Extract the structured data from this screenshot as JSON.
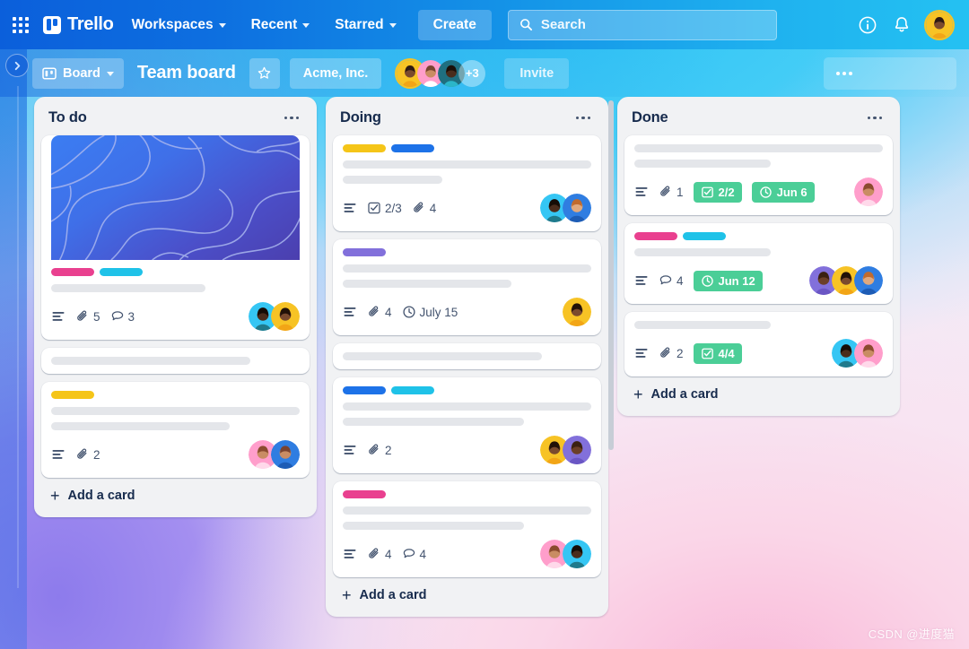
{
  "topnav": {
    "app_switcher_icon": "grid-apps-icon",
    "brand": "Trello",
    "items": [
      {
        "label": "Workspaces",
        "icon": "chevron-down-icon"
      },
      {
        "label": "Recent",
        "icon": "chevron-down-icon"
      },
      {
        "label": "Starred",
        "icon": "chevron-down-icon"
      }
    ],
    "create_label": "Create",
    "search": {
      "placeholder": "Search",
      "icon": "search-icon",
      "value": ""
    },
    "info_icon": "info-circle-icon",
    "bell_icon": "notification-bell-icon",
    "user_avatar": "user-avatar"
  },
  "boardbar": {
    "sidebar_toggle_icon": "chevron-right-icon",
    "view_label": "Board",
    "view_icon": "board-icon",
    "view_caret_icon": "chevron-down-icon",
    "title": "Team board",
    "star_icon": "star-icon",
    "workspace_label": "Acme, Inc.",
    "members_more": "+3",
    "invite_label": "Invite",
    "menu_icon": "more-horizontal-icon"
  },
  "colors": {
    "label_pink": "#e9408f",
    "label_cyan": "#1fc2e8",
    "label_yellow": "#f5c518",
    "label_blue": "#1d72e8",
    "label_purple": "#8270db",
    "badge_green": "#4bce97",
    "cover_from": "#3b7df2",
    "cover_to": "#4b3fae"
  },
  "lists": [
    {
      "title": "To do",
      "menu_icon": "more-horizontal-icon",
      "add_card_label": "Add a card",
      "cards": [
        {
          "cover": true,
          "labels": [
            "#e9408f",
            "#1fc2e8"
          ],
          "lines": [
            62
          ],
          "badges": [
            {
              "type": "description",
              "icon": "description-icon"
            },
            {
              "type": "attachment",
              "icon": "attachment-icon",
              "text": "5"
            },
            {
              "type": "comment",
              "icon": "comment-icon",
              "text": "3"
            }
          ],
          "avatars": [
            "#35c6f4",
            "#f5c518"
          ]
        },
        {
          "cover": false,
          "labels": [],
          "lines": [
            80
          ],
          "badges": [],
          "avatars": []
        },
        {
          "cover": false,
          "labels": [
            "#f5c518"
          ],
          "lines": [
            100,
            72
          ],
          "badges": [
            {
              "type": "description",
              "icon": "description-icon"
            },
            {
              "type": "attachment",
              "icon": "attachment-icon",
              "text": "2"
            }
          ],
          "avatars": [
            "#ff9ecb",
            "#2f7de1"
          ]
        }
      ]
    },
    {
      "title": "Doing",
      "menu_icon": "more-horizontal-icon",
      "add_card_label": "Add a card",
      "cards": [
        {
          "cover": false,
          "labels": [
            "#f5c518",
            "#1d72e8"
          ],
          "lines": [
            100,
            40
          ],
          "badges": [
            {
              "type": "description",
              "icon": "description-icon"
            },
            {
              "type": "checklist",
              "icon": "checklist-icon",
              "text": "2/3"
            },
            {
              "type": "attachment",
              "icon": "attachment-icon",
              "text": "4"
            }
          ],
          "avatars": [
            "#35c6f4",
            "#2f7de1"
          ]
        },
        {
          "cover": false,
          "labels": [
            "#8270db"
          ],
          "lines": [
            100,
            68
          ],
          "badges": [
            {
              "type": "description",
              "icon": "description-icon"
            },
            {
              "type": "attachment",
              "icon": "attachment-icon",
              "text": "4"
            },
            {
              "type": "due",
              "icon": "clock-icon",
              "text": "July 15"
            }
          ],
          "avatars": [
            "#f5c518"
          ]
        },
        {
          "cover": false,
          "labels": [],
          "lines": [
            80
          ],
          "badges": [],
          "avatars": []
        },
        {
          "cover": false,
          "labels": [
            "#1d72e8",
            "#1fc2e8"
          ],
          "lines": [
            100,
            73
          ],
          "badges": [
            {
              "type": "description",
              "icon": "description-icon"
            },
            {
              "type": "attachment",
              "icon": "attachment-icon",
              "text": "2"
            }
          ],
          "avatars": [
            "#f5c518",
            "#8270db"
          ]
        },
        {
          "cover": false,
          "labels": [
            "#e9408f"
          ],
          "lines": [
            100,
            73
          ],
          "badges": [
            {
              "type": "description",
              "icon": "description-icon"
            },
            {
              "type": "attachment",
              "icon": "attachment-icon",
              "text": "4"
            },
            {
              "type": "comment",
              "icon": "comment-icon",
              "text": "4"
            }
          ],
          "avatars": [
            "#ff9ecb",
            "#35c6f4"
          ]
        }
      ]
    },
    {
      "title": "Done",
      "menu_icon": "more-horizontal-icon",
      "add_card_label": "Add a card",
      "cards": [
        {
          "cover": false,
          "labels": [],
          "lines": [
            100,
            55
          ],
          "badges": [
            {
              "type": "description",
              "icon": "description-icon"
            },
            {
              "type": "attachment",
              "icon": "attachment-icon",
              "text": "1"
            },
            {
              "type": "checklist-done",
              "icon": "checklist-icon",
              "text": "2/2"
            },
            {
              "type": "due-done",
              "icon": "clock-icon",
              "text": "Jun 6"
            }
          ],
          "avatars": [
            "#ff9ecb"
          ]
        },
        {
          "cover": false,
          "labels": [
            "#e9408f",
            "#1fc2e8"
          ],
          "lines": [
            55
          ],
          "badges": [
            {
              "type": "description",
              "icon": "description-icon"
            },
            {
              "type": "comment",
              "icon": "comment-icon",
              "text": "4"
            },
            {
              "type": "due-done",
              "icon": "clock-icon",
              "text": "Jun 12"
            }
          ],
          "avatars": [
            "#8270db",
            "#f5c518",
            "#2f7de1"
          ]
        },
        {
          "cover": false,
          "labels": [],
          "lines": [
            55
          ],
          "badges": [
            {
              "type": "description",
              "icon": "description-icon"
            },
            {
              "type": "attachment",
              "icon": "attachment-icon",
              "text": "2"
            },
            {
              "type": "checklist-done",
              "icon": "checklist-icon",
              "text": "4/4"
            }
          ],
          "avatars": [
            "#35c6f4",
            "#ff9ecb"
          ]
        }
      ]
    }
  ],
  "watermark": "CSDN @进度猫"
}
